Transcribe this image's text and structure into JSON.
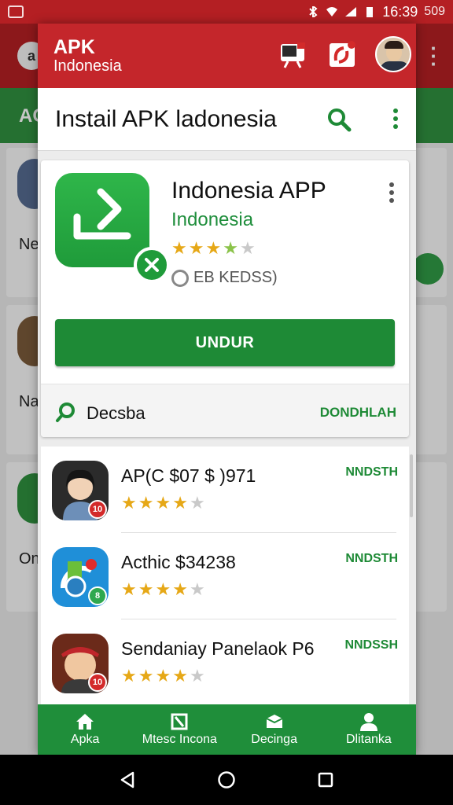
{
  "status_bar": {
    "time": "16:39",
    "extra": "509"
  },
  "background": {
    "tab_label": "AC",
    "card_labels": [
      "Ne",
      "Na",
      "On"
    ]
  },
  "app_bar": {
    "title": "APK",
    "subtitle": "Indonesia"
  },
  "search_header": {
    "title": "Instail APK ladonesia"
  },
  "featured_app": {
    "name": "Indonesia APP",
    "developer": "Indonesia",
    "rating": 4,
    "size_text": "EB KEDSS)",
    "install_label": "UNDUR",
    "description_label": "Decsba",
    "download_label": "DONDHLAH"
  },
  "list": {
    "items": [
      {
        "title": "AP(C $07 $ )971",
        "rating": 4,
        "action": "NNDSTH",
        "badge": "10"
      },
      {
        "title": "Acthic $34238",
        "rating": 4,
        "action": "NNDSTH",
        "badge": "8"
      },
      {
        "title": "Sendaniay Panelaok P6",
        "rating": 4,
        "action": "NNDSSH",
        "badge": "10"
      }
    ]
  },
  "bottom_nav": {
    "items": [
      {
        "label": "Apka",
        "icon": "home-icon"
      },
      {
        "label": "Mtesc Incona",
        "icon": "apps-icon"
      },
      {
        "label": "Decinga",
        "icon": "box-icon"
      },
      {
        "label": "Dlitanka",
        "icon": "person-icon"
      }
    ]
  },
  "colors": {
    "brand_red": "#c4262b",
    "brand_green": "#1e8a36",
    "star_gold": "#e6a817",
    "star_green": "#8bc34a",
    "star_empty": "#c9c9c9"
  }
}
